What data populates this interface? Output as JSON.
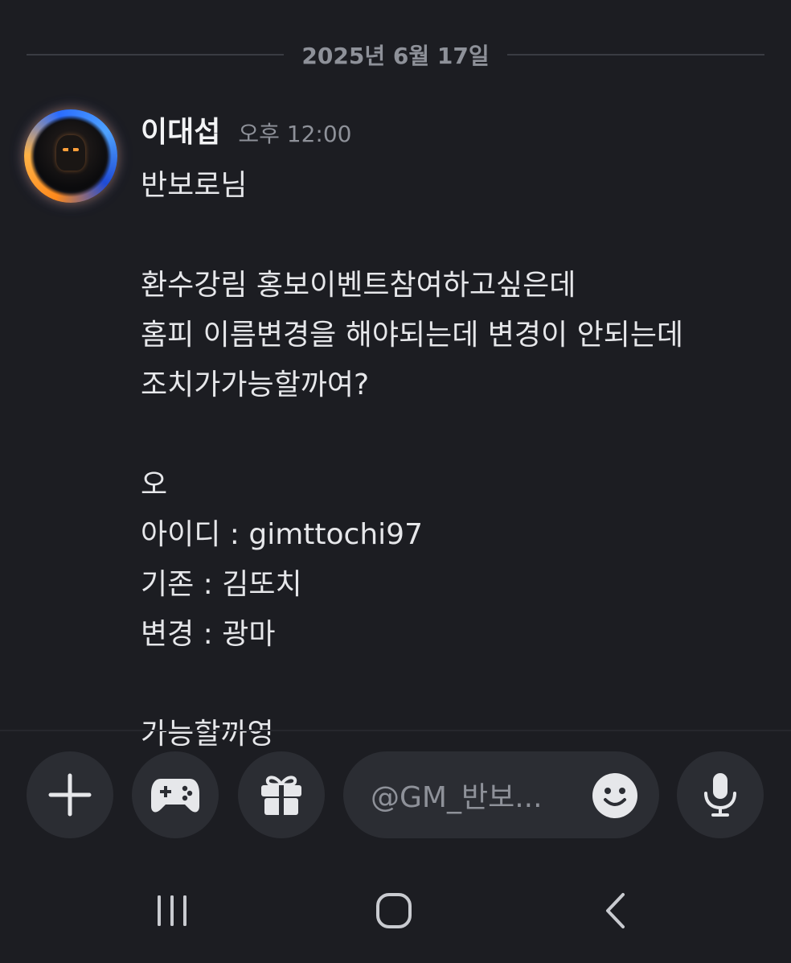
{
  "date_divider": {
    "text": "2025년 6월 17일"
  },
  "message": {
    "author": "이대섭",
    "timestamp": "오후 12:00",
    "lines": [
      "반보로님",
      "환수강림 홍보이벤트참여하고싶은데",
      "홈피 이름변경을 해야되는데 변경이 안되는데",
      "조치가가능할까여?",
      "오",
      "아이디 : gimttochi97",
      "기존 : 김또치",
      "변경 : 광마",
      "",
      "가능할까영"
    ]
  },
  "input_bar": {
    "placeholder": "@GM_반보...",
    "buttons": [
      "plus-icon",
      "gamepad-icon",
      "gift-icon",
      "emoji-icon",
      "mic-icon"
    ]
  },
  "nav_bar": {
    "buttons": [
      "recent-apps-icon",
      "home-icon",
      "back-icon"
    ]
  },
  "colors": {
    "background": "#1c1d22",
    "button_bg": "#2b2d33",
    "muted_text": "#8e9199",
    "text": "#e6e7ea"
  }
}
